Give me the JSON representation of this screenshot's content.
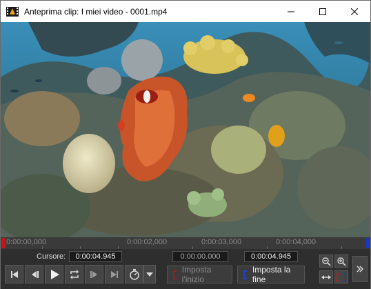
{
  "window": {
    "title": "Anteprima clip: I miei video - 0001.mp4"
  },
  "timeline": {
    "tick_labels": [
      "0:00:00,000",
      "0:00:02,000",
      "0:00:03,000",
      "0:00:04,000"
    ]
  },
  "controls": {
    "cursor_label": "Cursore:",
    "cursor_time": "0:00:04.945",
    "start_time": "0:00:00.000",
    "end_time": "0:00:04.945",
    "set_start_label": "Imposta l'inizio",
    "set_end_label": "Imposta la fine"
  },
  "colors": {
    "start_marker": "#c01818",
    "end_marker": "#1838c0"
  }
}
